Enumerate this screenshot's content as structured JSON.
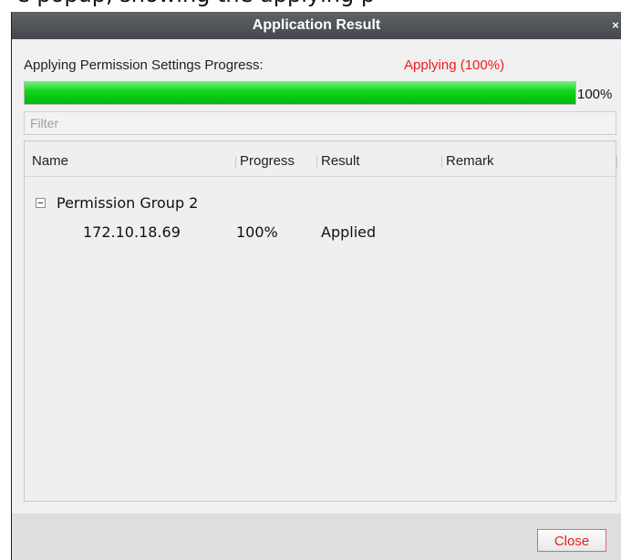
{
  "background_caption": "e popup, showing the applying p",
  "dialog": {
    "title": "Application Result",
    "close_glyph": "×"
  },
  "progress": {
    "label": "Applying Permission Settings Progress:",
    "status": "Applying (100%)",
    "percent_text": "100%",
    "fill_percent": 100,
    "status_color": "#ee1c1c",
    "bar_color": "#12d61a"
  },
  "filter": {
    "placeholder": "Filter",
    "value": ""
  },
  "table": {
    "columns": [
      "Name",
      "Progress",
      "Result",
      "Remark"
    ],
    "group": {
      "name": "Permission Group 2",
      "expanded": true,
      "children": [
        {
          "name": "172.10.18.69",
          "progress": "100%",
          "result": "Applied",
          "remark": ""
        }
      ]
    }
  },
  "footer": {
    "close_label": "Close"
  }
}
